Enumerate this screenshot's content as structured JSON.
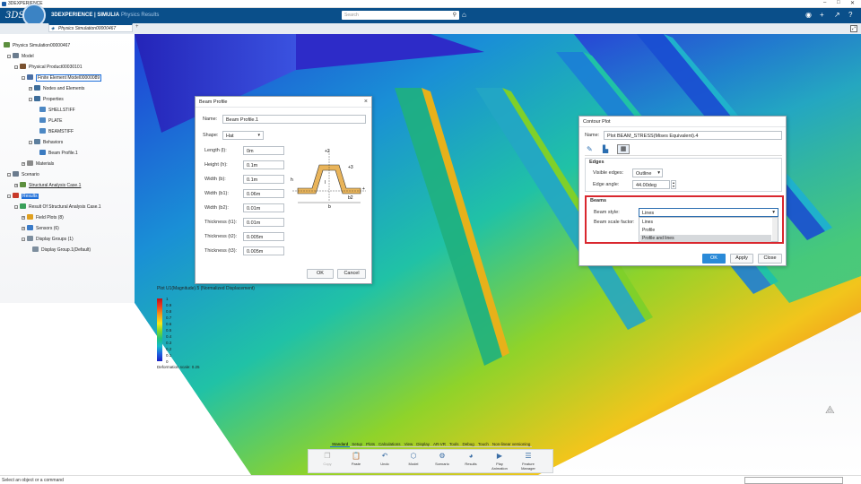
{
  "os": {
    "title": "3DEXPERIENCE"
  },
  "header": {
    "brand_bold": "3DEXPERIENCE | SIMULIA",
    "brand_sub": "Physics Results",
    "search_placeholder": "Search"
  },
  "tab": {
    "label": "Physics Simulation00000467",
    "add": "+"
  },
  "tree": {
    "root": "Physics Simulation00000467",
    "model": "Model",
    "physical_product": "Physical Product00030101",
    "fem": "Finite Element Model00000089",
    "nodes": "Nodes and Elements",
    "properties": "Properties",
    "shellstiff": "SHELLSTIFF",
    "plate": "PLATE",
    "beamstiff": "BEAMSTIFF",
    "behaviors": "Behaviors",
    "beam_profile": "Beam Profile.1",
    "materials": "Materials",
    "scenario": "Scenario",
    "analysis_case": "Structural Analysis Case.1",
    "results": "Results",
    "result_of": "Result Of Structural Analysis Case.1",
    "field_plots": "Field Plots (8)",
    "sensors": "Sensors (6)",
    "display_groups": "Display Groups (1)",
    "display_group1": "Display Group.1(Default)"
  },
  "beam_profile": {
    "title": "Beam Profile",
    "name_label": "Name:",
    "name_value": "Beam Profile.1",
    "shape_label": "Shape:",
    "shape_value": "Hat",
    "rows": [
      {
        "label": "Length (l):",
        "value": "0m"
      },
      {
        "label": "Height (h):",
        "value": "0.1m"
      },
      {
        "label": "Width (b):",
        "value": "0.1m"
      },
      {
        "label": "Width (b1):",
        "value": "0.06m"
      },
      {
        "label": "Width (b2):",
        "value": "0.01m"
      },
      {
        "label": "Thickness (t1):",
        "value": "0.01m"
      },
      {
        "label": "Thickness (t2):",
        "value": "0.005m"
      },
      {
        "label": "Thickness (t3):",
        "value": "0.005m"
      }
    ],
    "ok": "OK",
    "cancel": "Cancel"
  },
  "contour": {
    "title": "Contour Plot",
    "name_label": "Name:",
    "name_value": "Plot BEAM_STRESS(Mises Equivalent).4",
    "edges_header": "Edges",
    "visible_edges_label": "Visible edges:",
    "visible_edges_value": "Outline",
    "edge_angle_label": "Edge angle:",
    "edge_angle_value": "44.00deg",
    "beams_header": "Beams",
    "beam_style_label": "Beam style:",
    "beam_style_value": "Lines",
    "beam_scale_label": "Beam scale factor:",
    "options": [
      "Lines",
      "Profile",
      "Profile and lines"
    ],
    "ok": "OK",
    "apply": "Apply",
    "close": "Close",
    "highlight_color": "#d9272e"
  },
  "legend": {
    "title": "Plot U1(Magnitude).5 (Normalized Displacement)",
    "ticks": [
      "1",
      "0.9",
      "0.8",
      "0.7",
      "0.6",
      "0.5",
      "0.4",
      "0.3",
      "0.2",
      "0.1",
      "0"
    ],
    "deformation": "Deformation scale: 0.25"
  },
  "toolbar": {
    "tabs": [
      "Standard",
      "Setup",
      "Plots",
      "Calculations",
      "View",
      "Display",
      "AR-VR",
      "Tools",
      "Debug",
      "Touch",
      "Non-linear versioning"
    ],
    "buttons": [
      {
        "label": "Copy",
        "icon": "copy-icon",
        "enabled": false
      },
      {
        "label": "Paste",
        "icon": "paste-icon",
        "enabled": true
      },
      {
        "label": "Undo",
        "icon": "undo-icon",
        "enabled": true
      },
      {
        "label": "Model",
        "icon": "model-icon",
        "enabled": true
      },
      {
        "label": "Scenario",
        "icon": "scenario-icon",
        "enabled": true
      },
      {
        "label": "Results",
        "icon": "results-icon",
        "enabled": true
      },
      {
        "label": "Play Animation",
        "icon": "play-animation-icon",
        "enabled": true
      },
      {
        "label": "Feature Manager",
        "icon": "feature-manager-icon",
        "enabled": true
      }
    ]
  },
  "status": {
    "text": "Select an object or a command"
  }
}
